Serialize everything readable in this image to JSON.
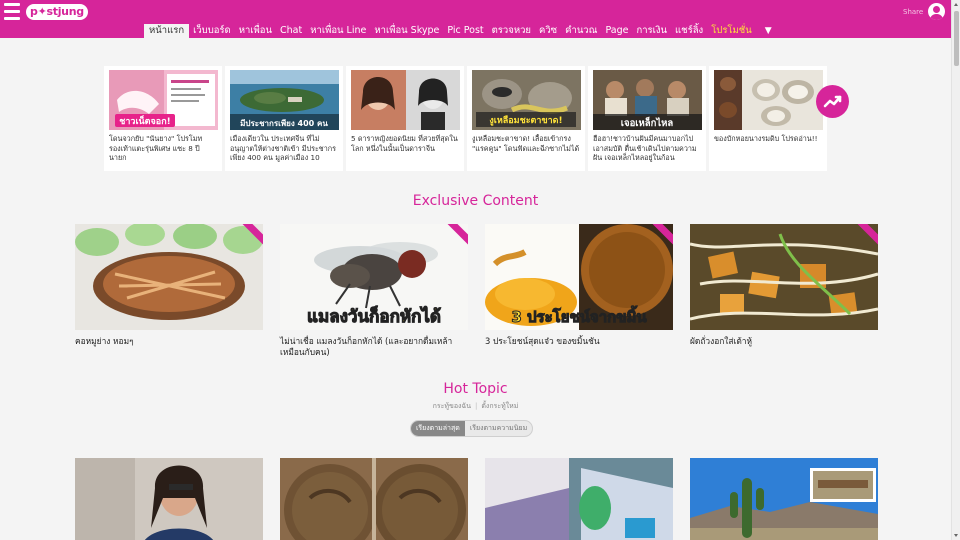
{
  "header": {
    "logo_text": "p✦stjung",
    "share_label": "Share",
    "nav": [
      {
        "label": "หน้าแรก",
        "active": true
      },
      {
        "label": "เว็บบอร์ด"
      },
      {
        "label": "หาเพื่อน"
      },
      {
        "label": "Chat"
      },
      {
        "label": "หาเพื่อน Line"
      },
      {
        "label": "หาเพื่อน Skype"
      },
      {
        "label": "Pic Post"
      },
      {
        "label": "ตรวจหวย"
      },
      {
        "label": "ควิซ"
      },
      {
        "label": "คำนวณ"
      },
      {
        "label": "Page"
      },
      {
        "label": "การเงิน"
      },
      {
        "label": "แชร์ลิ้ง"
      },
      {
        "label": "โปรโมชั่น",
        "promo": true
      },
      {
        "label": "▼",
        "more": true
      }
    ]
  },
  "trending": [
    {
      "caption": "โดนจวกยับ \"นันยาง\" โปรโมท รองเท้าแตะรุ่นพิเศษ แซะ 8 ปี นายก",
      "image_text": "ชาวเน็ตจอก!",
      "image_icon": "sandal-promo-image"
    },
    {
      "caption": "เมืองเดียวใน ประเทศจีน ที่ไม่อนุญาตให้ต่างชาติเข้า มีประชากรเพียง 400 คน มูลค่าเมือง 10",
      "image_text": "มีประชากรเพียง 400 คน",
      "image_icon": "island-aerial-image"
    },
    {
      "caption": "5 ดาราหญิงยอดนิยม ที่สวยที่สุดในโลก หนึ่งในนั้นเป็นดาราจีน",
      "image_text": "",
      "image_icon": "actress-portraits-image"
    },
    {
      "caption": "งูเหลือมชะตาขาด! เลื้อยเข้ากรง \"แรคคูน\" โดนฟัดและฉีกซากไม่ได้",
      "image_text": "งูเหลือมชะตาขาด!",
      "image_icon": "raccoon-snake-image"
    },
    {
      "caption": "ฮือฮา!ชาวบ้านฝันมีคนมาบอกไปเอาสมบัติ ตื่นเช้าเดินไปตามความฝัน เจอเหล็กไหลอยู่ในก้อน",
      "image_text": "เจอเหล็กไหล",
      "image_icon": "villagers-treasure-image"
    },
    {
      "caption": "ของบักหอยนางรมดิบ โปรดอ่าน!!",
      "image_text": "",
      "image_icon": "oysters-image"
    }
  ],
  "exclusive": {
    "title": "Exclusive Content",
    "items": [
      {
        "caption": "คอหมูย่าง หอมๆ",
        "image_icon": "grilled-pork-image",
        "image_text": ""
      },
      {
        "caption": "ไม่น่าเชื่อ แมลงวันก็อกหักได้ (และอยากดื่มเหล้าเหมือนกับคน)",
        "image_icon": "housefly-image",
        "image_text": "แมลงวันก็อกหักได้"
      },
      {
        "caption": "3 ประโยชน์สุดแจ๋ว ของขมิ้นชัน",
        "image_icon": "turmeric-image",
        "image_text": "3 ประโยชน์จากขมิ้น"
      },
      {
        "caption": "ผัดถั่วงอกใส่เต้าหู้",
        "image_icon": "tofu-beansprouts-image",
        "image_text": ""
      }
    ]
  },
  "hot": {
    "title": "Hot Topic",
    "links": [
      "กระทู้ของฉัน",
      "ตั้งกระทู้ใหม่"
    ],
    "sort_options": [
      {
        "label": "เรียงตามล่าสุด",
        "active": true
      },
      {
        "label": "เรียงตามความนิยม",
        "active": false
      }
    ],
    "items": [
      {
        "image_icon": "man-portrait-image"
      },
      {
        "image_icon": "ancient-coins-image"
      },
      {
        "image_icon": "pool-scene-image"
      },
      {
        "image_icon": "desert-cactus-image"
      }
    ]
  },
  "colors": {
    "brand": "#d6259a",
    "promo": "#ffe23a",
    "background": "#f4f4f4"
  }
}
